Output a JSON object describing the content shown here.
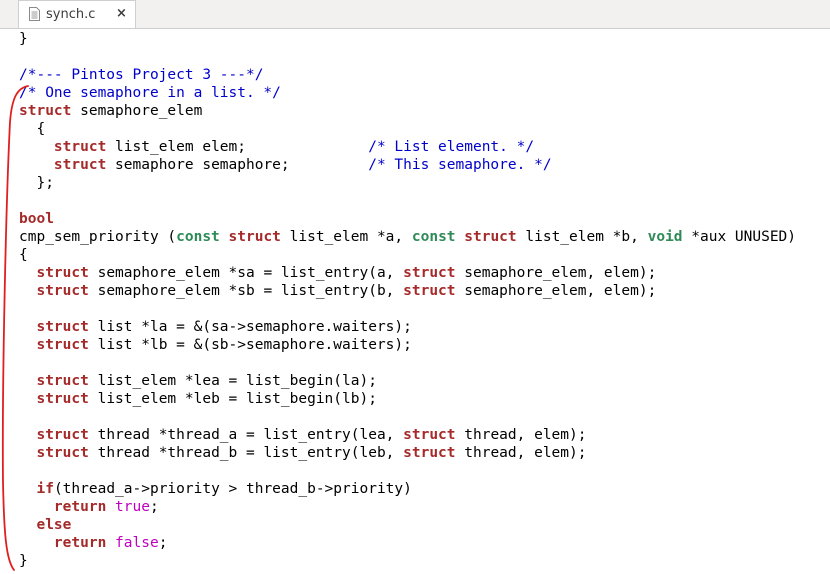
{
  "tab": {
    "label": "synch.c",
    "close": "×",
    "icon": "text-file-icon"
  },
  "code_lines": [
    [
      [
        "p",
        "}"
      ]
    ],
    [
      [
        "p",
        ""
      ]
    ],
    [
      [
        "c",
        "/*--- Pintos Project 3 ---*/"
      ]
    ],
    [
      [
        "c",
        "/* One semaphore in a list. */"
      ]
    ],
    [
      [
        "k",
        "struct"
      ],
      [
        "p",
        " semaphore_elem"
      ]
    ],
    [
      [
        "p",
        "  {"
      ]
    ],
    [
      [
        "p",
        "    "
      ],
      [
        "k",
        "struct"
      ],
      [
        "p",
        " list_elem elem;              "
      ],
      [
        "c",
        "/* List element. */"
      ]
    ],
    [
      [
        "p",
        "    "
      ],
      [
        "k",
        "struct"
      ],
      [
        "p",
        " semaphore semaphore;         "
      ],
      [
        "c",
        "/* This semaphore. */"
      ]
    ],
    [
      [
        "p",
        "  };"
      ]
    ],
    [
      [
        "p",
        ""
      ]
    ],
    [
      [
        "k",
        "bool"
      ]
    ],
    [
      [
        "p",
        "cmp_sem_priority ("
      ],
      [
        "t",
        "const"
      ],
      [
        "p",
        " "
      ],
      [
        "k",
        "struct"
      ],
      [
        "p",
        " list_elem *a, "
      ],
      [
        "t",
        "const"
      ],
      [
        "p",
        " "
      ],
      [
        "k",
        "struct"
      ],
      [
        "p",
        " list_elem *b, "
      ],
      [
        "t",
        "void"
      ],
      [
        "p",
        " *aux UNUSED)"
      ]
    ],
    [
      [
        "p",
        "{"
      ]
    ],
    [
      [
        "p",
        "  "
      ],
      [
        "k",
        "struct"
      ],
      [
        "p",
        " semaphore_elem *sa = list_entry(a, "
      ],
      [
        "k",
        "struct"
      ],
      [
        "p",
        " semaphore_elem, elem);"
      ]
    ],
    [
      [
        "p",
        "  "
      ],
      [
        "k",
        "struct"
      ],
      [
        "p",
        " semaphore_elem *sb = list_entry(b, "
      ],
      [
        "k",
        "struct"
      ],
      [
        "p",
        " semaphore_elem, elem);"
      ]
    ],
    [
      [
        "p",
        ""
      ]
    ],
    [
      [
        "p",
        "  "
      ],
      [
        "k",
        "struct"
      ],
      [
        "p",
        " list *la = &(sa->semaphore.waiters);"
      ]
    ],
    [
      [
        "p",
        "  "
      ],
      [
        "k",
        "struct"
      ],
      [
        "p",
        " list *lb = &(sb->semaphore.waiters);"
      ]
    ],
    [
      [
        "p",
        ""
      ]
    ],
    [
      [
        "p",
        "  "
      ],
      [
        "k",
        "struct"
      ],
      [
        "p",
        " list_elem *lea = list_begin(la);"
      ]
    ],
    [
      [
        "p",
        "  "
      ],
      [
        "k",
        "struct"
      ],
      [
        "p",
        " list_elem *leb = list_begin(lb);"
      ]
    ],
    [
      [
        "p",
        ""
      ]
    ],
    [
      [
        "p",
        "  "
      ],
      [
        "k",
        "struct"
      ],
      [
        "p",
        " thread *thread_a = list_entry(lea, "
      ],
      [
        "k",
        "struct"
      ],
      [
        "p",
        " thread, elem);"
      ]
    ],
    [
      [
        "p",
        "  "
      ],
      [
        "k",
        "struct"
      ],
      [
        "p",
        " thread *thread_b = list_entry(leb, "
      ],
      [
        "k",
        "struct"
      ],
      [
        "p",
        " thread, elem);"
      ]
    ],
    [
      [
        "p",
        ""
      ]
    ],
    [
      [
        "p",
        "  "
      ],
      [
        "k",
        "if"
      ],
      [
        "p",
        "(thread_a->priority > thread_b->priority)"
      ]
    ],
    [
      [
        "p",
        "    "
      ],
      [
        "k",
        "return"
      ],
      [
        "p",
        " "
      ],
      [
        "l",
        "true"
      ],
      [
        "p",
        ";"
      ]
    ],
    [
      [
        "p",
        "  "
      ],
      [
        "k",
        "else"
      ]
    ],
    [
      [
        "p",
        "    "
      ],
      [
        "k",
        "return"
      ],
      [
        "p",
        " "
      ],
      [
        "l",
        "false"
      ],
      [
        "p",
        ";"
      ]
    ],
    [
      [
        "p",
        "}"
      ]
    ]
  ],
  "colors": {
    "keyword": "#a52a2a",
    "type_keyword": "#2e8b57",
    "comment": "#0000cd",
    "literal": "#c000c0",
    "annotation": "#e02020"
  }
}
